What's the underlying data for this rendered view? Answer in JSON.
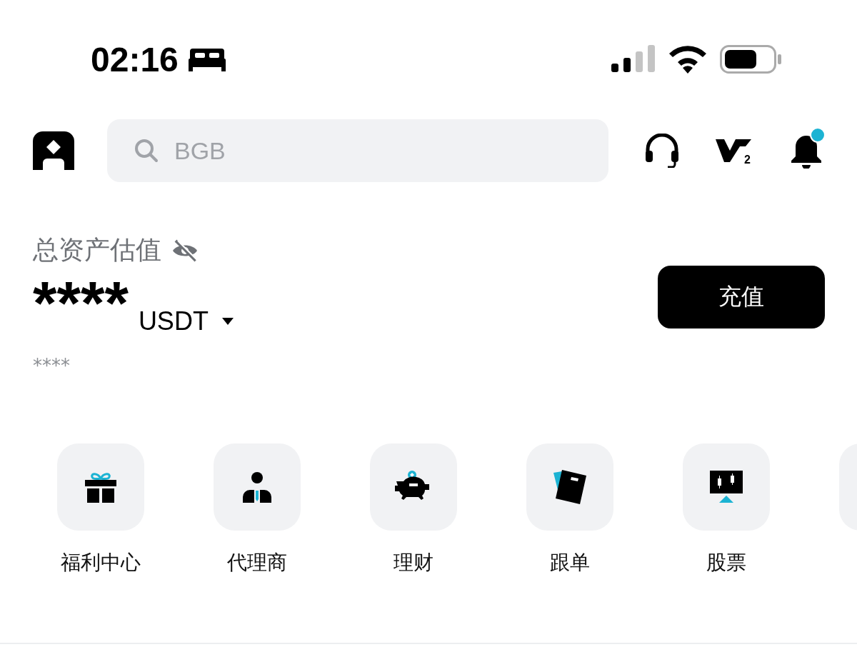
{
  "status_bar": {
    "time": "02:16"
  },
  "header": {
    "vip_level": "2",
    "search": {
      "placeholder": "BGB"
    },
    "notifications": {
      "unread": true
    }
  },
  "assets": {
    "label": "总资产估值",
    "hidden": true,
    "amount": "****",
    "currency": "USDT",
    "sub_amount": "****",
    "deposit_button": "充值"
  },
  "shortcuts": [
    {
      "kind": "gift",
      "label": "福利中心"
    },
    {
      "kind": "agent",
      "label": "代理商"
    },
    {
      "kind": "savings",
      "label": "理财"
    },
    {
      "kind": "copy",
      "label": "跟单"
    },
    {
      "kind": "stocks",
      "label": "股票"
    }
  ]
}
